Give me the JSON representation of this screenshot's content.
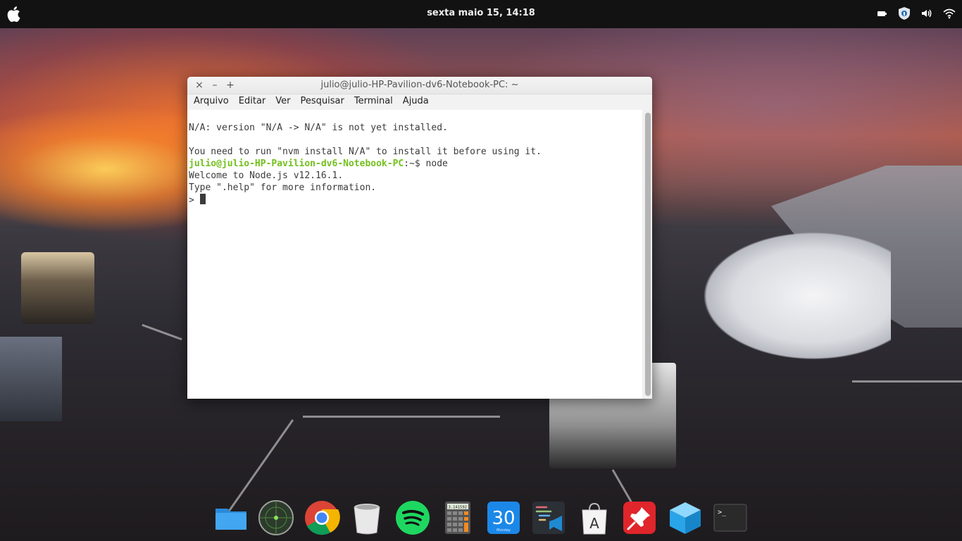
{
  "panel": {
    "clock": "sexta maio 15, 14:18",
    "apple_icon": "apple-logo-icon",
    "tray_icons": [
      "battery-icon",
      "security-shield-icon",
      "volume-icon",
      "wifi-icon"
    ]
  },
  "terminal": {
    "title": "julio@julio-HP-Pavilion-dv6-Notebook-PC: ~",
    "buttons": {
      "close": "×",
      "minimize": "–",
      "maximize": "+"
    },
    "menu": [
      "Arquivo",
      "Editar",
      "Ver",
      "Pesquisar",
      "Terminal",
      "Ajuda"
    ],
    "lines": {
      "l1": "N/A: version \"N/A -> N/A\" is not yet installed.",
      "l2": "",
      "l3": "You need to run \"nvm install N/A\" to install it before using it.",
      "prompt_user": "julio@julio-HP-Pavilion-dv6-Notebook-PC",
      "prompt_rest": ":~$ node",
      "l5": "Welcome to Node.js v12.16.1.",
      "l6": "Type \".help\" for more information.",
      "l7": ">"
    },
    "colors": {
      "prompt": "#73c01e",
      "text": "#3c3c3c"
    }
  },
  "dock": {
    "items": [
      {
        "name": "files-folder-icon"
      },
      {
        "name": "radar-app-icon"
      },
      {
        "name": "chrome-browser-icon"
      },
      {
        "name": "trash-icon"
      },
      {
        "name": "spotify-icon"
      },
      {
        "name": "calculator-icon",
        "display": "3.141592"
      },
      {
        "name": "calendar-icon",
        "day": "30",
        "weekday": "Monday"
      },
      {
        "name": "code-editor-icon"
      },
      {
        "name": "app-store-icon",
        "letter": "A"
      },
      {
        "name": "pin-app-icon"
      },
      {
        "name": "box-app-icon"
      },
      {
        "name": "terminal-app-icon",
        "prompt": ">_"
      }
    ]
  }
}
